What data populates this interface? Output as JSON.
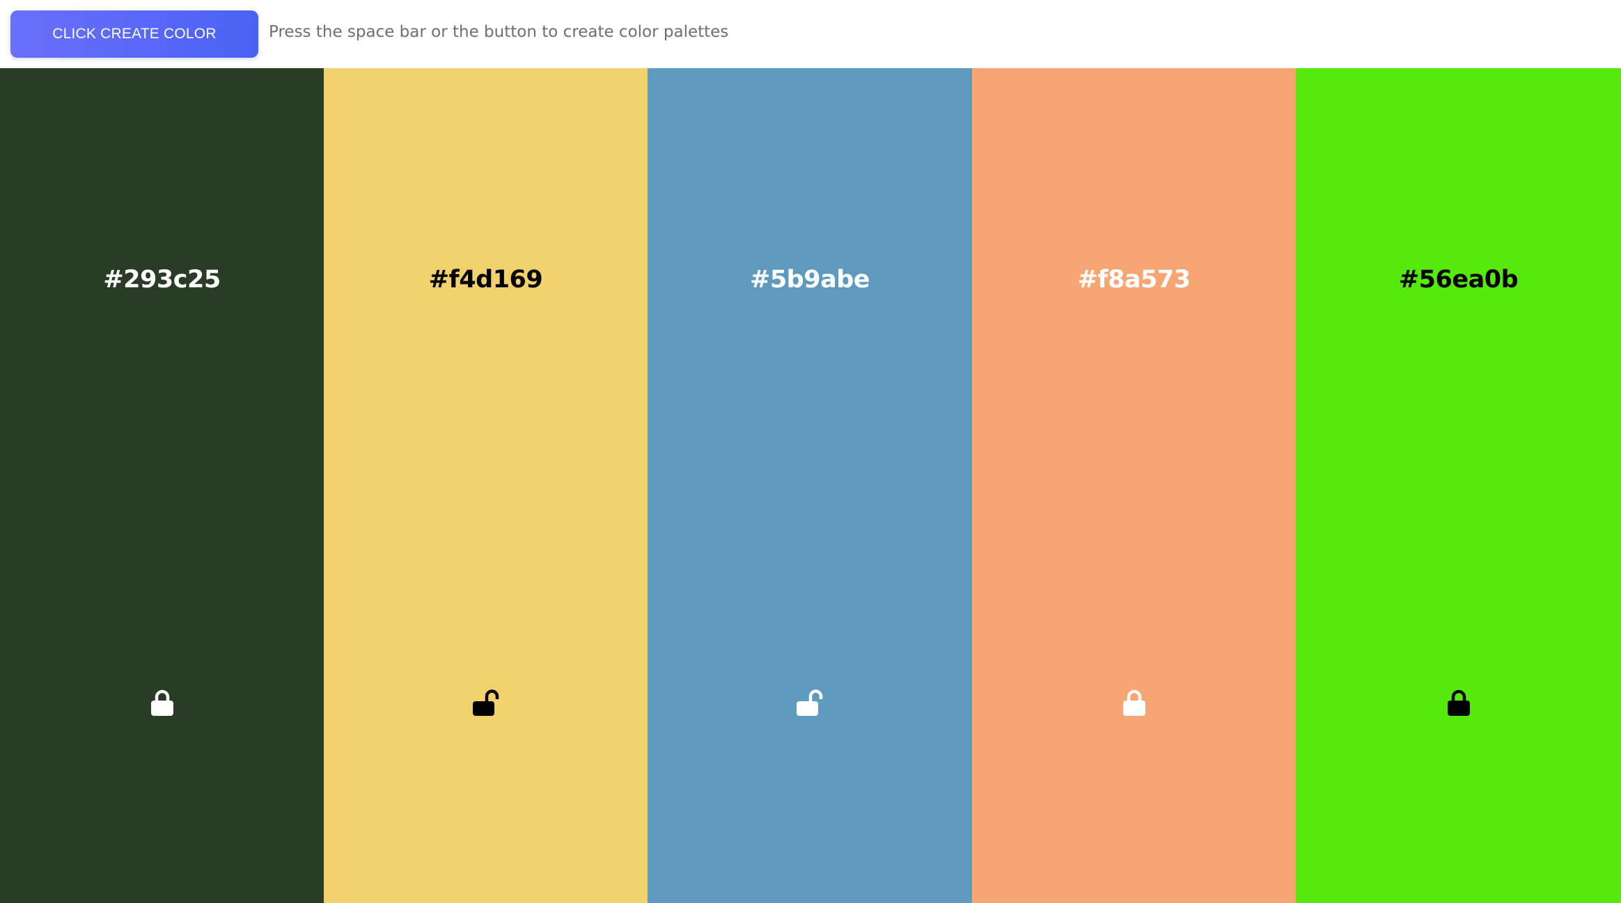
{
  "header": {
    "button_label": "CLICK CREATE COLOR",
    "hint_text": "Press the space bar or the button to create color palettes"
  },
  "swatches": [
    {
      "hex": "#293c25",
      "color": "#293c25",
      "text_color": "#ffffff",
      "locked": true,
      "icon": "lock-closed-icon"
    },
    {
      "hex": "#f4d169",
      "color": "#f2d06c",
      "text_color": "#000000",
      "locked": false,
      "icon": "lock-open-icon"
    },
    {
      "hex": "#5b9abe",
      "color": "#5e9abe",
      "text_color": "#ffffff",
      "locked": false,
      "icon": "lock-open-icon"
    },
    {
      "hex": "#f8a573",
      "color": "#f7a573",
      "text_color": "#ffffff",
      "locked": true,
      "icon": "lock-closed-icon"
    },
    {
      "hex": "#56ea0b",
      "color": "#55ea0b",
      "text_color": "#000000",
      "locked": true,
      "icon": "lock-closed-icon"
    }
  ]
}
